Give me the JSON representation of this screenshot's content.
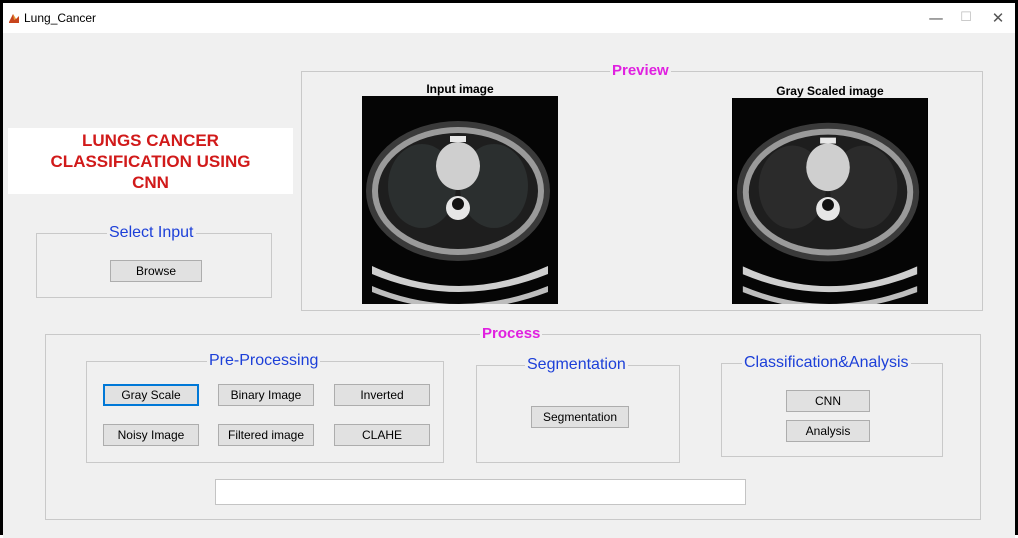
{
  "window": {
    "title": "Lung_Cancer",
    "controls": {
      "minimize": "—",
      "maximize": "☐",
      "close": "✕"
    }
  },
  "headline": "LUNGS CANCER CLASSIFICATION USING CNN",
  "select_input": {
    "title": "Select Input",
    "browse_label": "Browse"
  },
  "preview": {
    "title": "Preview",
    "input_image_title": "Input image",
    "gray_image_title": "Gray Scaled image"
  },
  "process": {
    "title": "Process",
    "preprocessing": {
      "title": "Pre-Processing",
      "buttons": {
        "gray_scale": "Gray Scale",
        "binary_image": "Binary Image",
        "inverted": "Inverted",
        "noisy_image": "Noisy Image",
        "filtered_image": "Filtered image",
        "clahe": "CLAHE"
      }
    },
    "segmentation": {
      "title": "Segmentation",
      "button": "Segmentation"
    },
    "classification": {
      "title": "Classification&Analysis",
      "cnn": "CNN",
      "analysis": "Analysis"
    },
    "status_value": ""
  },
  "colors": {
    "headline": "#d11a1a",
    "section_title_magenta": "#e020e0",
    "panel_title_blue": "#1c3fd8",
    "background": "#f0f0f0"
  }
}
